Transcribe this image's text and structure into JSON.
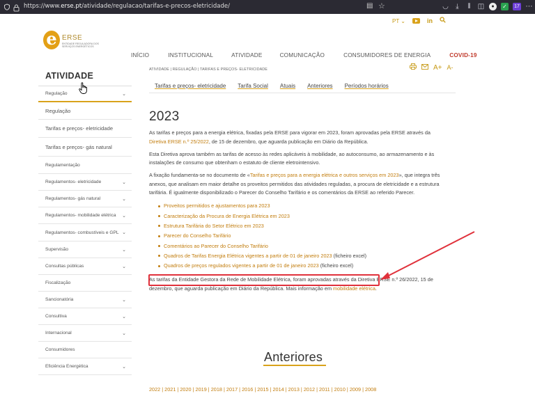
{
  "browser": {
    "url_prefix": "https://www.",
    "url_host": "erse.pt",
    "url_path": "/atividade/regulacao/tarifas-e-precos-eletricidade/",
    "badge_count": "17"
  },
  "utility": {
    "lang": "PT",
    "linkedin": "in"
  },
  "logo": {
    "mark": "e",
    "name": "ERSE",
    "subtitle": "ENTIDADE REGULADORA DOS SERVIÇOS ENERGÉTICOS"
  },
  "nav": {
    "items": [
      "INÍCIO",
      "INSTITUCIONAL",
      "ATIVIDADE",
      "COMUNICAÇÃO",
      "CONSUMIDORES DE ENERGIA",
      "COVID-19"
    ]
  },
  "sidebar": {
    "title": "ATIVIDADE",
    "items": [
      {
        "label": "Regulação",
        "chevron": true
      },
      {
        "label": "Regulação",
        "chevron": false
      },
      {
        "label": "Tarifas e preços- eletricidade",
        "chevron": false
      },
      {
        "label": "Tarifas e preços- gás natural",
        "chevron": false
      },
      {
        "label": "Regulamentação",
        "chevron": false
      },
      {
        "label": "Regulamentos- eletricidade",
        "chevron": true
      },
      {
        "label": "Regulamentos- gás natural",
        "chevron": true
      },
      {
        "label": "Regulamentos- mobilidade elétrica",
        "chevron": true
      },
      {
        "label": "Regulamentos- combustíveis e GPL",
        "chevron": true
      },
      {
        "label": "Supervisão",
        "chevron": true
      },
      {
        "label": "Consultas públicas",
        "chevron": true
      },
      {
        "label": "Fiscalização",
        "chevron": false
      },
      {
        "label": "Sancionatória",
        "chevron": true
      },
      {
        "label": "Consultiva",
        "chevron": true
      },
      {
        "label": "Internacional",
        "chevron": true
      },
      {
        "label": "Consumidores",
        "chevron": false
      },
      {
        "label": "Eficiência Energética",
        "chevron": true
      }
    ]
  },
  "breadcrumb": "ATIVIDADE | REGULAÇÃO | TARIFAS E PREÇOS- ELETRICIDADE",
  "tools": {
    "font_up": "A+",
    "font_down": "A-"
  },
  "subtabs": [
    "Tarifas e preços- eletricidade",
    "Tarifa Social",
    "Atuais",
    "Anteriores",
    "Períodos horários"
  ],
  "content": {
    "heading": "2023",
    "p1_a": "As tarifas e preços para a energia elétrica, fixadas pela ERSE para vigorar em 2023, foram aprovadas pela ERSE através da ",
    "p1_link": "Diretiva ERSE n.º 25/2022",
    "p1_b": ", de 15 de dezembro, que aguarda publicação em Diário da República.",
    "p2": "Esta Diretiva aprova também as tarifas de acesso às redes aplicáveis à mobilidade, ao autoconsumo, ao armazenamento e às instalações de consumo que obtenham o estatuto de cliente eletrointensivo.",
    "p3_a": "A fixação fundamenta-se no documento de «",
    "p3_link": "Tarifas e preços para a energia elétrica e outros serviços em 2023",
    "p3_b": "», que integra três anexos, que analisam em maior detalhe os proveitos permitidos das atividades reguladas, a procura de eletricidade e a estrutura tarifária. É igualmente disponibilizado o Parecer do Conselho Tarifário e os comentários da ERSE ao referido Parecer.",
    "bullets": [
      {
        "label": "Proveitos permitidos e ajustamentos para 2023",
        "note": ""
      },
      {
        "label": "Caracterização da Procura de Energia Elétrica em 2023",
        "note": ""
      },
      {
        "label": "Estrutura Tarifária do Setor Elétrico em 2023",
        "note": ""
      },
      {
        "label": "Parecer do Conselho Tarifário",
        "note": ""
      },
      {
        "label": "Comentários ao Parecer do Conselho Tarifário",
        "note": ""
      },
      {
        "label": "Quadros de Tarifas Energia Elétrica vigentes a partir de 01 de janeiro 2023",
        "note": " (ficheiro excel)"
      },
      {
        "label": "Quadros de preços regulados vigentes a partir de 01 de janeiro 2023",
        "note": " (ficheiro excel)"
      }
    ],
    "p4_a": "As tarifas da Entidade Gestora da Rede de Mobilidade Elétrica, foram aprovadas através da Diretiva ERSE n.º 26/2022, 15 de dezembro, que aguarda publicação em Diário da República. Mais informação em ",
    "p4_link": "mobilidade elétrica",
    "p4_b": "."
  },
  "anteriores": {
    "title": "Anteriores",
    "years": "2022 | 2021 | 2020 | 2019 | 2018 | 2017 | 2016 | 2015 | 2014 | 2013 | 2012 | 2011 | 2010 | 2009 | 2008"
  },
  "colors": {
    "accent": "#c27d0e",
    "highlight": "#e0313b",
    "covid": "#c0392b"
  }
}
